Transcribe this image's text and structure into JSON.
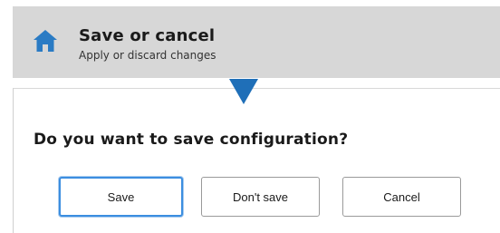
{
  "header": {
    "icon": "home-icon",
    "title": "Save or cancel",
    "subtitle": "Apply or discard changes"
  },
  "pointer": {
    "icon": "arrow-down-icon",
    "color": "#1f6fb8"
  },
  "dialog": {
    "question": "Do you want to save configuration?",
    "buttons": {
      "save": "Save",
      "dont_save": "Don't save",
      "cancel": "Cancel"
    },
    "focused_button": "save",
    "focus_color": "#3c8ee0"
  },
  "colors": {
    "header_bg": "#d7d7d7",
    "icon_blue": "#2a7bc4"
  }
}
